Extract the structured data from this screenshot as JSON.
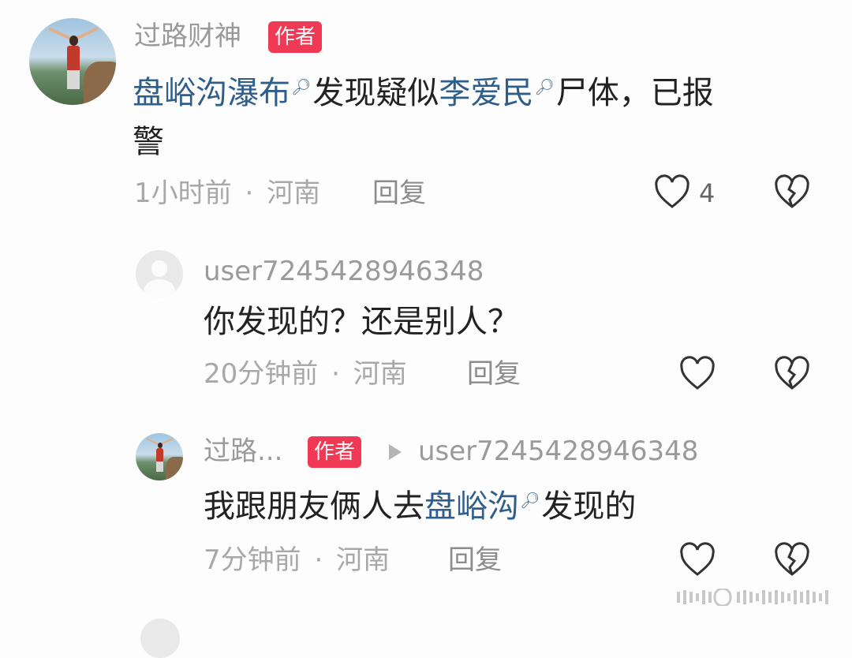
{
  "comments": [
    {
      "author": "过路财神",
      "badge": "作者",
      "text_parts": {
        "link1": "盘峪沟瀑布",
        "plain1": "发现疑似",
        "link2": "李爱民",
        "plain2": "尸体，已报",
        "line2": "警"
      },
      "time": "1小时前",
      "location": "河南",
      "reply_label": "回复",
      "like_count": "4"
    },
    {
      "author": "user7245428946348",
      "text": "你发现的？还是别人？",
      "time": "20分钟前",
      "location": "河南",
      "reply_label": "回复"
    },
    {
      "author": "过路...",
      "badge": "作者",
      "reply_to": "user7245428946348",
      "text_parts": {
        "plain1": "我跟朋友俩人去",
        "link1": "盘峪沟",
        "plain2": "发现的"
      },
      "time": "7分钟前",
      "location": "河南",
      "reply_label": "回复"
    }
  ],
  "meta_separator": "·",
  "icons": {
    "search_mark": "search-icon",
    "like": "heart-icon",
    "dislike": "broken-heart-icon",
    "reply_arrow": "triangle-right-icon"
  },
  "colors": {
    "badge": "#f03a55",
    "link": "#2e5e8c"
  }
}
